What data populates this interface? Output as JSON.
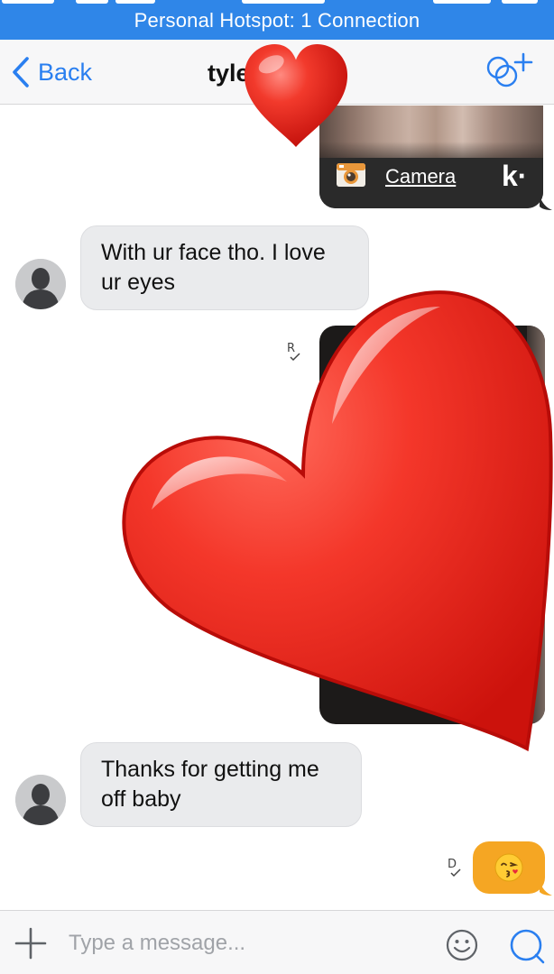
{
  "status_bar": {
    "hotspot_text": "Personal Hotspot: 1 Connection"
  },
  "navbar": {
    "back_label": "Back",
    "title": "tyle"
  },
  "messages": [
    {
      "type": "media",
      "from": "me",
      "link_label": "Camera",
      "logo": "k·"
    },
    {
      "type": "text",
      "from": "them",
      "text": "With ur face tho. I love ur eyes"
    },
    {
      "type": "media",
      "from": "me",
      "receipt": "R"
    },
    {
      "type": "text",
      "from": "them",
      "text": "Thanks for getting me off baby"
    },
    {
      "type": "emoji",
      "from": "me",
      "emoji": "😘",
      "receipt": "D"
    }
  ],
  "input_bar": {
    "placeholder": "Type a message..."
  },
  "colors": {
    "hotspot_blue": "#2f86e8",
    "link_blue": "#2a7ff0",
    "incoming_bubble": "#eaebed",
    "outgoing_emoji_bubble": "#f5a623",
    "heart_red": "#e8231b"
  },
  "icons": [
    "chevron-left-icon",
    "add-contact-icon",
    "camera-icon",
    "person-icon",
    "read-receipt-icon",
    "delivered-receipt-icon",
    "plus-icon",
    "smiley-icon",
    "search-icon",
    "heart-sticker-icon"
  ]
}
